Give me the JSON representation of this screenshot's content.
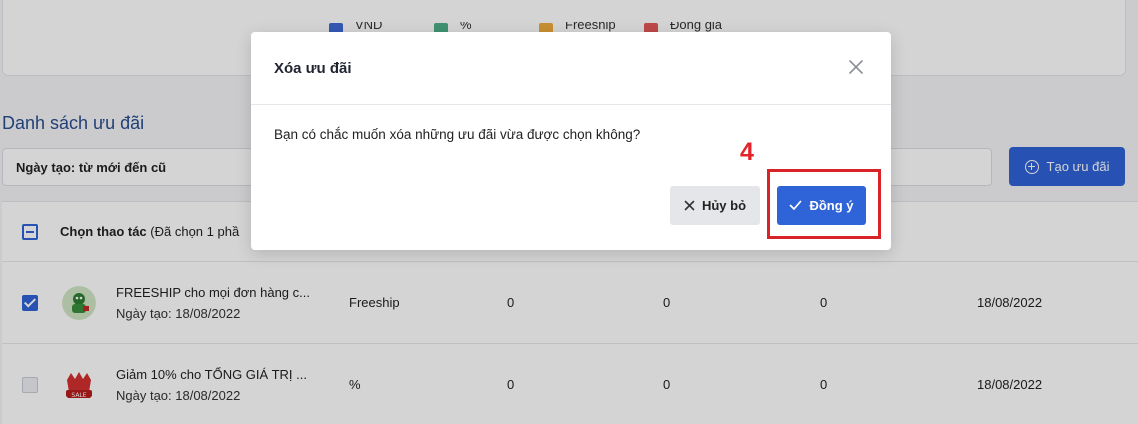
{
  "legend": {
    "items": [
      {
        "label": "VND",
        "color": "#3f6ad8"
      },
      {
        "label": "%",
        "color": "#4caf8a"
      },
      {
        "label": "Freeship",
        "color": "#f0ad3b"
      },
      {
        "label": "Đồng giá",
        "color": "#e45757"
      }
    ]
  },
  "list": {
    "title": "Danh sách ưu đãi",
    "sort_label": "Ngày tạo: từ mới đến cũ",
    "create_button": "Tạo ưu đãi",
    "bulk_action": {
      "label_bold": "Chọn thao tác",
      "label_rest": " (Đã chọn 1 phầ"
    },
    "rows": [
      {
        "name": "FREESHIP cho mọi đơn hàng c...",
        "created": "Ngày tạo: 18/08/2022",
        "type": "Freeship",
        "col1": "0",
        "col2": "0",
        "col3": "0",
        "date": "18/08/2022",
        "checked": true
      },
      {
        "name": "Giảm 10% cho TỔNG GIÁ TRỊ ...",
        "created": "Ngày tạo: 18/08/2022",
        "type": "%",
        "col1": "0",
        "col2": "0",
        "col3": "0",
        "date": "18/08/2022",
        "checked": false
      }
    ]
  },
  "modal": {
    "title": "Xóa ưu đãi",
    "message": "Bạn có chắc muốn xóa những ưu đãi vừa được chọn không?",
    "cancel_label": "Hủy bỏ",
    "confirm_label": "Đồng ý"
  },
  "annotation": {
    "step": "4",
    "color": "#d9232a"
  },
  "colors": {
    "primary": "#2f63d8"
  }
}
